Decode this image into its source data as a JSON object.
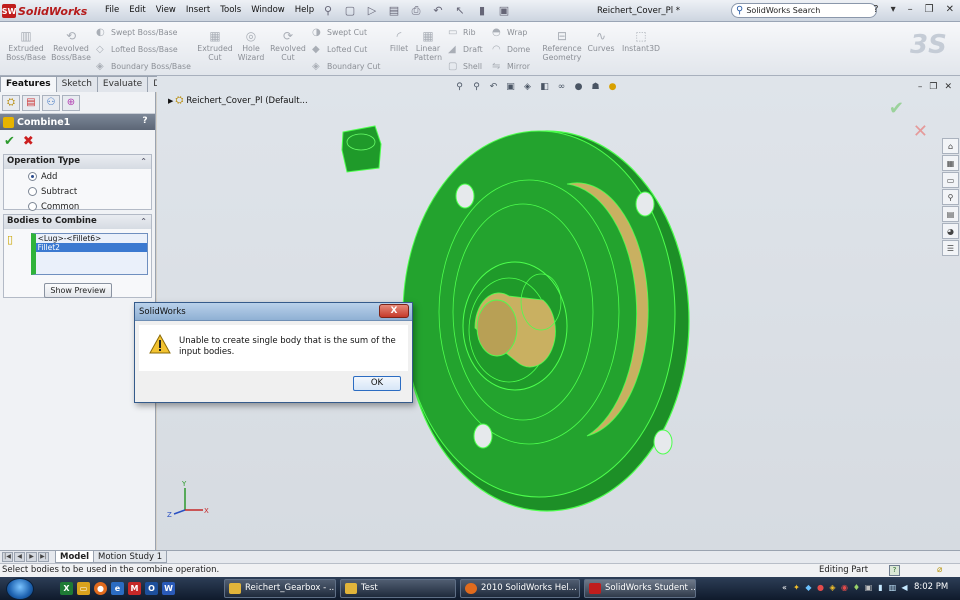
{
  "app": {
    "logo_text": "SolidWorks",
    "logo_badge": "SW",
    "menus": [
      "File",
      "Edit",
      "View",
      "Insert",
      "Tools",
      "Window",
      "Help"
    ],
    "document_title": "Reichert_Cover_Pl *",
    "search_placeholder": "SolidWorks Search"
  },
  "command_manager": {
    "large": [
      {
        "label_1": "Extruded",
        "label_2": "Boss/Base"
      },
      {
        "label_1": "Revolved",
        "label_2": "Boss/Base"
      },
      {
        "label_1": "Extruded",
        "label_2": "Cut"
      },
      {
        "label_1": "Hole",
        "label_2": "Wizard"
      },
      {
        "label_1": "Revolved",
        "label_2": "Cut"
      },
      {
        "label_1": "Fillet",
        "label_2": ""
      },
      {
        "label_1": "Linear",
        "label_2": "Pattern"
      },
      {
        "label_1": "Reference",
        "label_2": "Geometry"
      },
      {
        "label_1": "Curves",
        "label_2": ""
      },
      {
        "label_1": "Instant3D",
        "label_2": ""
      }
    ],
    "small": {
      "swept_boss": "Swept Boss/Base",
      "lofted_boss": "Lofted Boss/Base",
      "boundary_boss": "Boundary Boss/Base",
      "swept_cut": "Swept Cut",
      "lofted_cut": "Lofted Cut",
      "boundary_cut": "Boundary Cut",
      "rib": "Rib",
      "draft": "Draft",
      "shell": "Shell",
      "wrap": "Wrap",
      "dome": "Dome",
      "mirror": "Mirror"
    }
  },
  "manager_tabs": [
    "Features",
    "Sketch",
    "Evaluate",
    "DimXpert"
  ],
  "property_manager": {
    "title": "Combine1",
    "help": "?",
    "operation_group": {
      "title": "Operation Type",
      "options": [
        "Add",
        "Subtract",
        "Common"
      ],
      "selected": "Add"
    },
    "bodies_group": {
      "title": "Bodies to Combine",
      "items": [
        "<Lug>-<Fillet6>",
        "Fillet2"
      ],
      "selected_item": "Fillet2",
      "preview_button": "Show Preview"
    }
  },
  "viewport": {
    "tree_label": "Reichert_Cover_Pl  (Default..."
  },
  "dialog": {
    "title": "SolidWorks",
    "message": "Unable to create single body that is the sum of the input bodies.",
    "ok_label": "OK",
    "close_label": "X"
  },
  "bottom_tabs": [
    "Model",
    "Motion Study 1"
  ],
  "status": {
    "message": "Select bodies to be used in the combine operation.",
    "mode": "Editing Part"
  },
  "taskbar": {
    "quick_launch": [
      "X",
      "M",
      "W"
    ],
    "buttons": [
      "Reichert_Gearbox - ...",
      "Test",
      "2010 SolidWorks Hel...",
      "SolidWorks Student ..."
    ],
    "clock": "8:02 PM"
  },
  "colors": {
    "part_green": "#1f9a2a",
    "edge_green": "#4dff4d",
    "brass": "#c9b061",
    "accent_red": "#c01d1d"
  }
}
